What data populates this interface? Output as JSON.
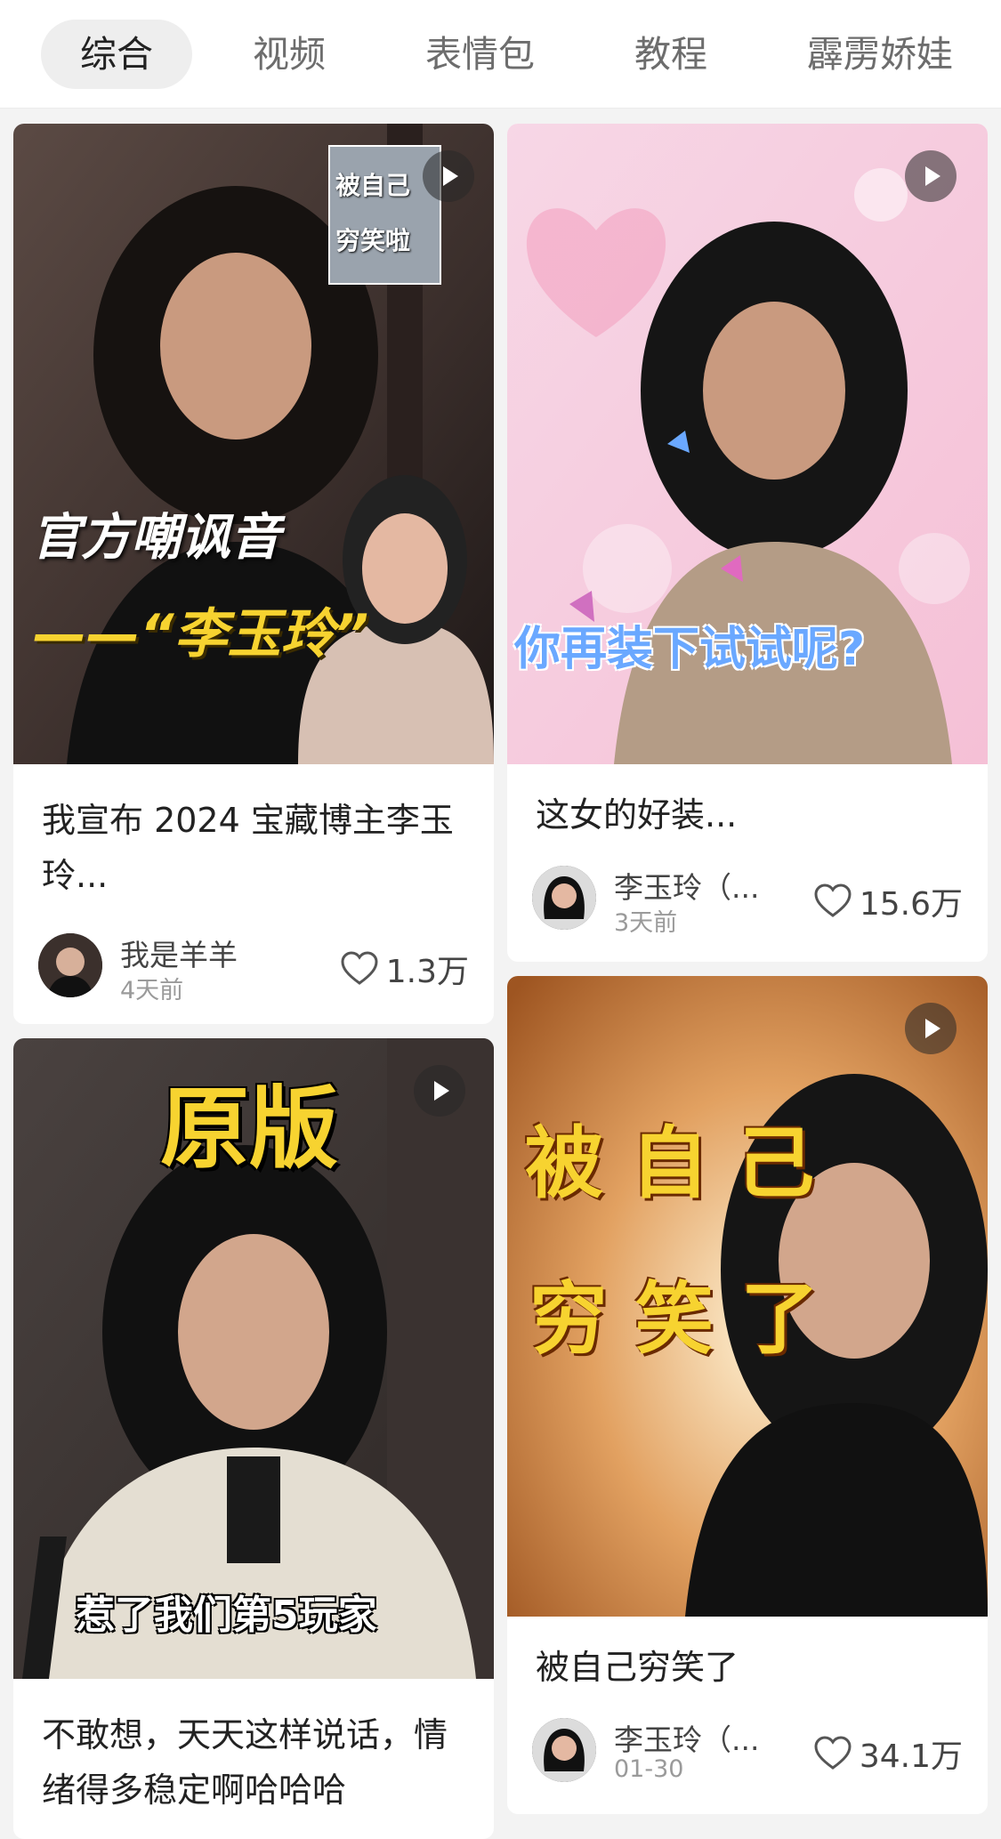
{
  "tabs": [
    {
      "label": "综合",
      "active": true
    },
    {
      "label": "视频"
    },
    {
      "label": "表情包"
    },
    {
      "label": "教程"
    },
    {
      "label": "霹雳娇娃"
    }
  ],
  "cards": [
    {
      "overlay": {
        "line1": "官方嘲讽音",
        "line2": "——“李玉玲”",
        "inset_line1": "被自己",
        "inset_line2": "穷笑啦"
      },
      "title": "我宣布 2024 宝藏博主李玉玲...",
      "author": "我是羊羊",
      "date": "4天前",
      "likes": "1.3万"
    },
    {
      "overlay": {
        "line1": "你再装下试试呢?"
      },
      "title": "这女的好装...",
      "author": "李玉玲（...",
      "date": "3天前",
      "likes": "15.6万"
    },
    {
      "overlay": {
        "line1": "原版",
        "line2": "惹了我们第5玩家"
      },
      "title": "不敢想，天天这样说话，情绪得多稳定啊哈哈哈",
      "author": "",
      "date": "",
      "likes": ""
    },
    {
      "overlay": {
        "line1": "被 自 己",
        "line2": "穷 笑 了"
      },
      "title": "被自己穷笑了",
      "author": "李玉玲（...",
      "date": "01-30",
      "likes": "34.1万"
    }
  ],
  "icons": {
    "play": "play-icon",
    "like": "heart-outline-icon"
  },
  "colors": {
    "tab_active_bg": "#eeeeee",
    "yellow_caption": "#f7d330",
    "blue_caption": "#6aa8ff"
  }
}
